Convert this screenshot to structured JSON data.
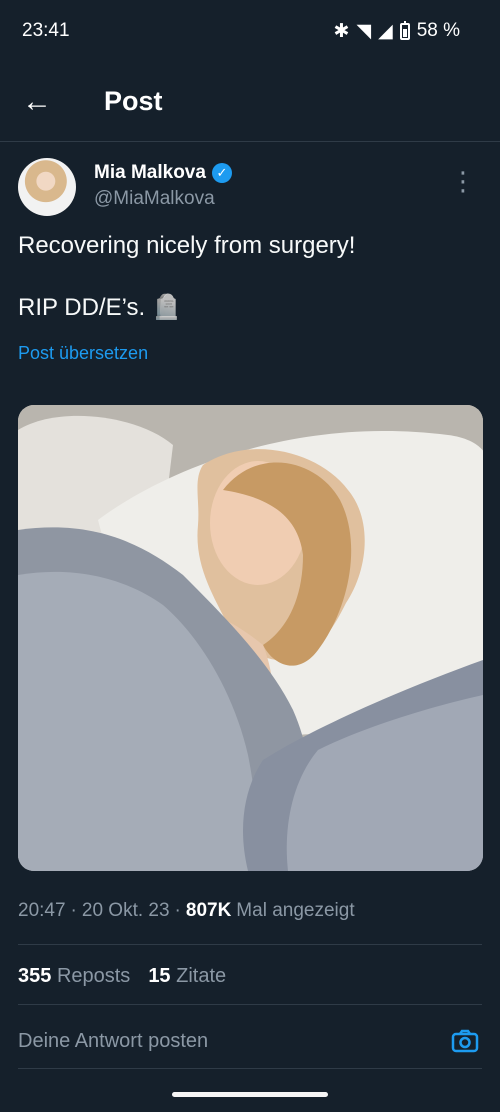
{
  "status_bar": {
    "time": "23:41",
    "battery": "58 %",
    "icons": [
      "bluetooth-icon",
      "wifi-icon",
      "signal-icon",
      "battery-icon"
    ]
  },
  "app_bar": {
    "title": "Post",
    "back_icon": "back-arrow-icon"
  },
  "author": {
    "name": "Mia Malkova",
    "handle": "@MiaMalkova",
    "verified": true
  },
  "tweet": {
    "line1": "Recovering nicely from surgery!",
    "line2": "RIP DD/E’s. 🪦",
    "translate": "Post übersetzen"
  },
  "media": {
    "description": "photo-in-bed"
  },
  "meta": {
    "time": "20:47",
    "date": "20 Okt. 23",
    "views": "807K",
    "views_label": "Mal angezeigt"
  },
  "stats": {
    "reposts_count": "355",
    "reposts_label": "Reposts",
    "quotes_count": "15",
    "quotes_label": "Zitate"
  },
  "reply": {
    "placeholder": "Deine Antwort posten"
  },
  "colors": {
    "background": "#15202b",
    "accent": "#1d9bf0",
    "muted": "#8b98a5"
  }
}
